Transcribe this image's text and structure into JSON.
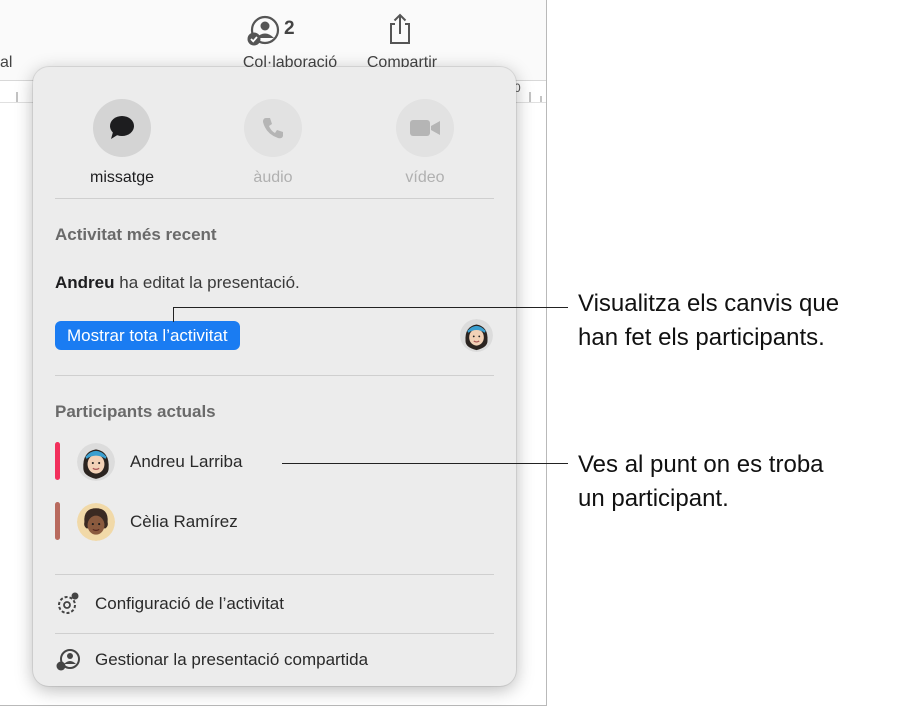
{
  "toolbar": {
    "partial_label": "al",
    "collaboration": {
      "count": "2",
      "label": "Col·laboració",
      "icon": "collaboration-icon"
    },
    "share": {
      "label": "Compartir",
      "icon": "share-icon"
    },
    "ruler_number": "0"
  },
  "popover": {
    "communication": [
      {
        "label": "missatge",
        "icon": "message-bubble-icon",
        "enabled": true
      },
      {
        "label": "àudio",
        "icon": "phone-icon",
        "enabled": false
      },
      {
        "label": "vídeo",
        "icon": "video-camera-icon",
        "enabled": false
      }
    ],
    "recent_activity": {
      "heading": "Activitat més recent",
      "editor_name": "Andreu",
      "activity_text": "ha editat la presentació.",
      "show_all_label": "Mostrar tota l’activitat"
    },
    "participants": {
      "heading": "Participants actuals",
      "list": [
        {
          "name": "Andreu Larriba",
          "color": "#f2305c"
        },
        {
          "name": "Cèlia Ramírez",
          "color": "#b86a5e"
        }
      ]
    },
    "menu": [
      {
        "label": "Configuració de l’activitat",
        "icon": "activity-settings-icon"
      },
      {
        "label": "Gestionar la presentació compartida",
        "icon": "manage-collaboration-icon"
      }
    ]
  },
  "callouts": [
    {
      "line1": "Visualitza els canvis que",
      "line2": "han fet els participants."
    },
    {
      "line1": "Ves al punt on es troba",
      "line2": "un participant."
    }
  ],
  "colors": {
    "accent_blue": "#1a7cf2",
    "popover_bg": "#ececec"
  }
}
